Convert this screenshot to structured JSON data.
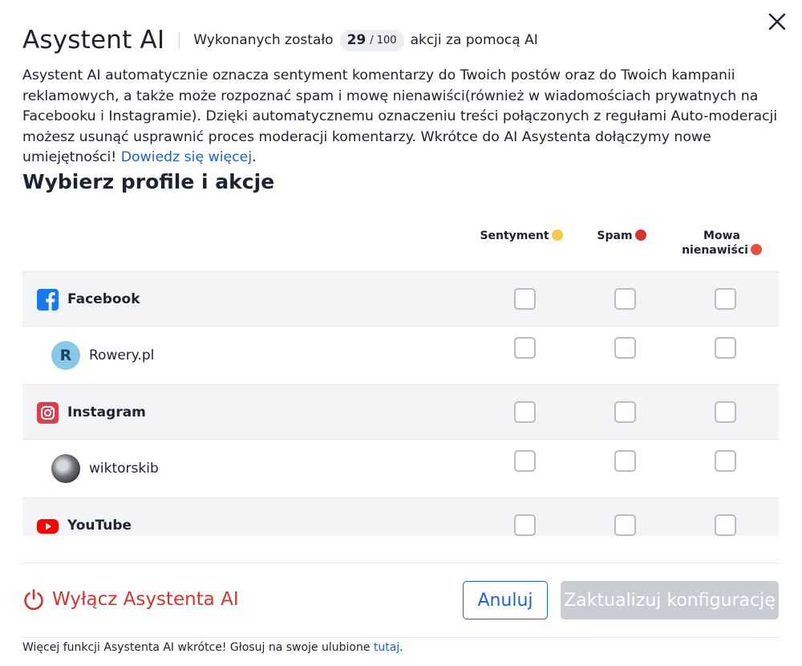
{
  "header": {
    "title": "Asystent AI",
    "counter_prefix": "Wykonanych zostało",
    "counter_used": "29",
    "counter_total": "/ 100",
    "counter_suffix": "akcji za pomocą AI"
  },
  "description": {
    "text": "Asystent AI automatycznie oznacza sentyment komentarzy do Twoich postów oraz do Twoich kampanii reklamowych, a także może rozpoznać spam i mowę nienawiści(również w wiadomościach prywatnych na Facebooku i Instagramie). Dzięki automatycznemu oznaczeniu treści połączonych z regułami Auto-moderacji możesz usunąć usprawnić proces moderacji komentarzy. Wkrótce do AI Asystenta dołączymy nowe umiejętności!",
    "link_text": "Dowiedz się więcej",
    "trailing": "."
  },
  "section_title": "Wybierz profile i akcje",
  "columns": {
    "sentiment": "Sentyment",
    "spam": "Spam",
    "hate_line1": "Mowa",
    "hate_line2": "nienawiści"
  },
  "rows": [
    {
      "type": "platform",
      "label": "Facebook",
      "icon": "facebook-icon"
    },
    {
      "type": "profile",
      "label": "Rowery.pl",
      "avatar_letter": "R"
    },
    {
      "type": "platform",
      "label": "Instagram",
      "icon": "instagram-icon"
    },
    {
      "type": "profile",
      "label": "wiktorskib",
      "avatar": "photo"
    },
    {
      "type": "platform",
      "label": "YouTube",
      "icon": "youtube-icon"
    }
  ],
  "actions": {
    "disable": "Wyłącz Asystenta AI",
    "cancel": "Anuluj",
    "update": "Zaktualizuj konfigurację"
  },
  "footer": {
    "text": "Więcej funkcji Asystenta AI wkrótce! Głosuj na swoje ulubione",
    "link_text": "tutaj",
    "trailing": "."
  },
  "colors": {
    "primary": "#1b64d6",
    "danger": "#d9342b",
    "disabled": "#c8ccd3",
    "facebook": "#1877f2",
    "instagram": "#dd3b4e",
    "youtube": "#ff0000"
  }
}
